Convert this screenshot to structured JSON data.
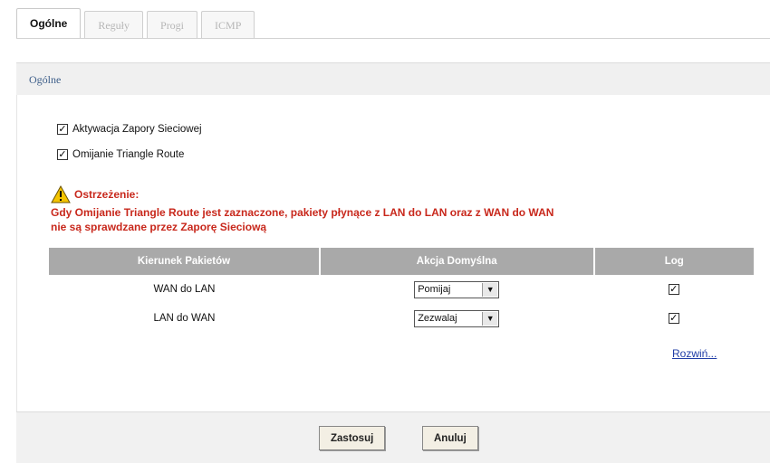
{
  "tabs": [
    {
      "label": "Ogólne"
    },
    {
      "label": "Reguły"
    },
    {
      "label": "Progi"
    },
    {
      "label": "ICMP"
    }
  ],
  "section": {
    "title": "Ogólne"
  },
  "checks": [
    {
      "label": "Aktywacja Zapory Sieciowej",
      "checked": true
    },
    {
      "label": "Omijanie Triangle Route",
      "checked": true
    }
  ],
  "warning": {
    "title": "Ostrzeżenie:",
    "line1": "Gdy Omijanie Triangle Route jest zaznaczone, pakiety płynące z LAN do LAN oraz z WAN do WAN",
    "line2": "nie są sprawdzane przez Zaporę Sieciową"
  },
  "table": {
    "headers": [
      "Kierunek Pakietów",
      "Akcja Domyślna",
      "Log"
    ],
    "rows": [
      {
        "direction": "WAN do LAN",
        "action": "Pomijaj",
        "log": true
      },
      {
        "direction": "LAN do WAN",
        "action": "Zezwalaj",
        "log": true
      }
    ]
  },
  "more_link": "Rozwiń...",
  "buttons": {
    "apply": "Zastosuj",
    "cancel": "Anuluj"
  },
  "colors": {
    "warning": "#c8281c",
    "header_bg": "#a9a9a9",
    "link": "#1f3ca6"
  }
}
